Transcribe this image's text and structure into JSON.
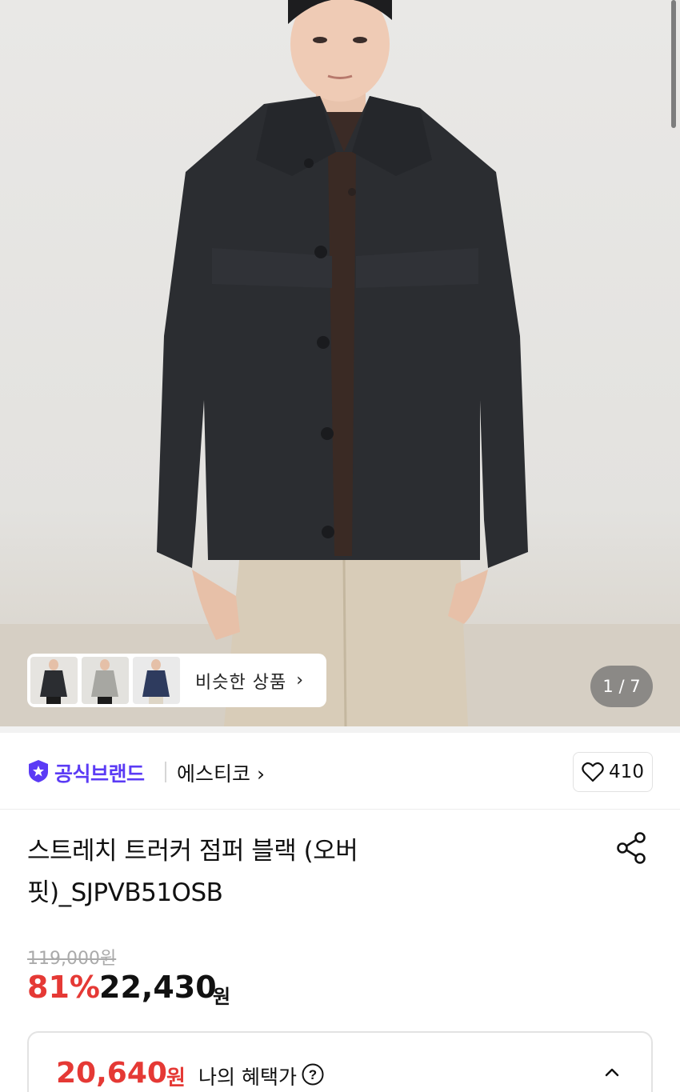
{
  "hero": {
    "similar_label": "비슷한 상품",
    "similar_chevron": "›",
    "counter": "1 / 7",
    "thumbnails": [
      {
        "name": "similar-thumb-black-jacket",
        "jacket_color": "#2b2d31"
      },
      {
        "name": "similar-thumb-gray-jacket",
        "jacket_color": "#a7a7a2"
      },
      {
        "name": "similar-thumb-navy-jacket",
        "jacket_color": "#2e3b5e"
      }
    ]
  },
  "brand": {
    "official_label": "공식브랜드",
    "name": "에스티코 ›",
    "like_count": "410",
    "accent_color": "#5b3bf5"
  },
  "product": {
    "title_line1": "스트레치 트러커 점퍼 블랙 (오버",
    "title_line2": "핏)_SJPVB51OSB"
  },
  "price": {
    "original": "119,000원",
    "discount": "81%",
    "sale": "22,430",
    "currency": "원",
    "accent_color": "#e53935"
  },
  "benefit": {
    "price": "20,640",
    "currency": "원",
    "label": "나의 혜택가"
  },
  "icons": [
    "star-badge-icon",
    "heart-icon",
    "share-icon",
    "help-icon",
    "chevron-up-icon"
  ]
}
